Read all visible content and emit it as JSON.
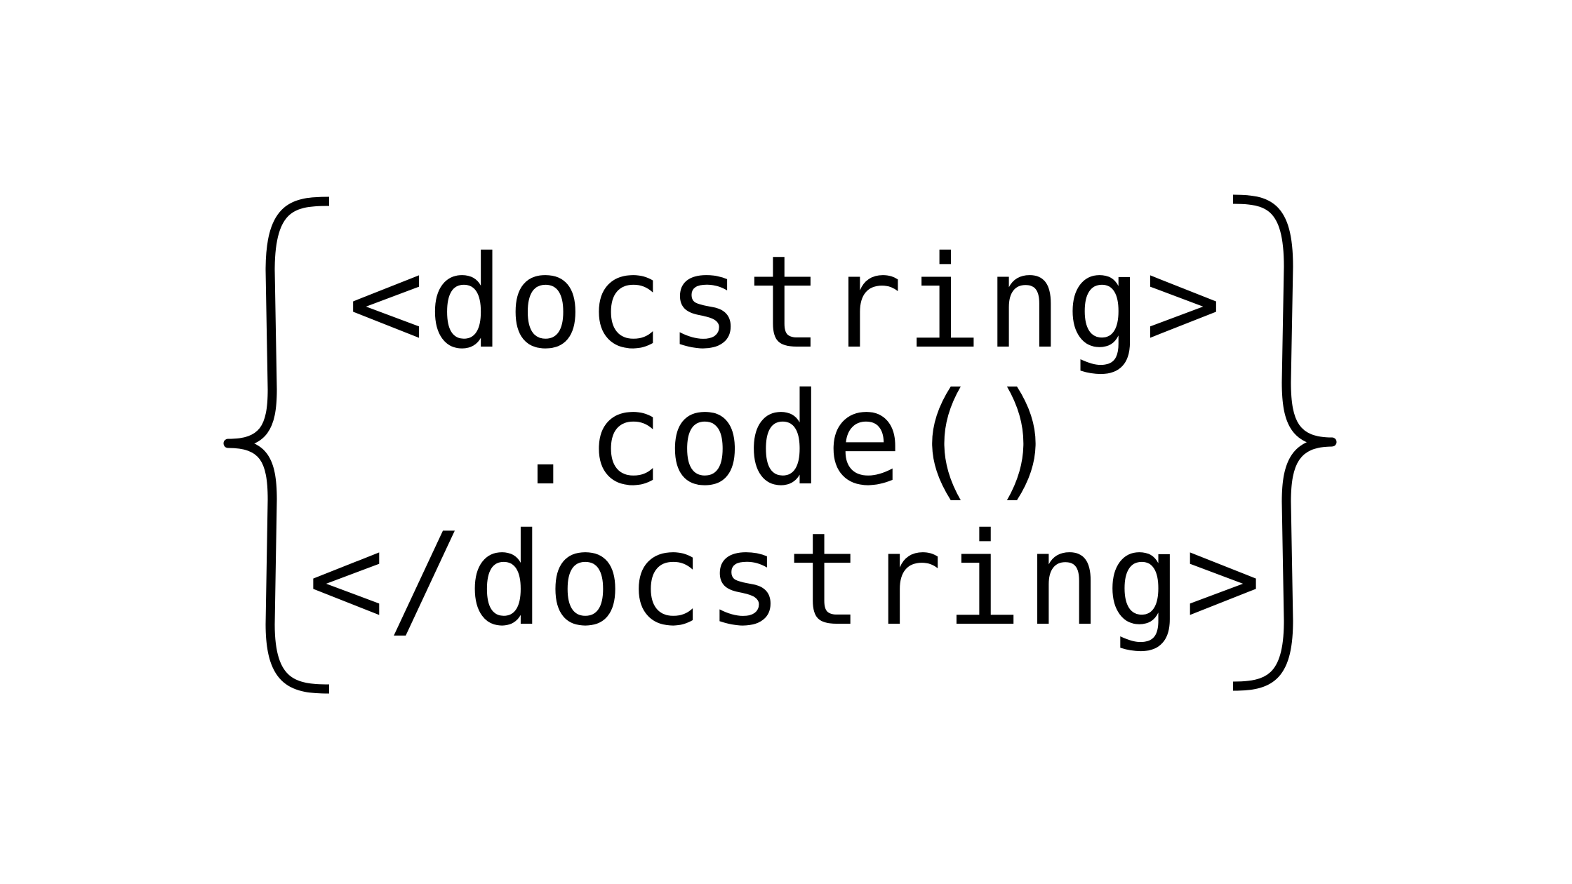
{
  "logo": {
    "open_tag": "<docstring>",
    "method": ".code()",
    "close_tag": "</docstring>",
    "left_brace_icon": "left-curly-brace-icon",
    "right_brace_icon": "right-curly-brace-icon",
    "text_color": "#000000",
    "background_color": "#ffffff"
  }
}
